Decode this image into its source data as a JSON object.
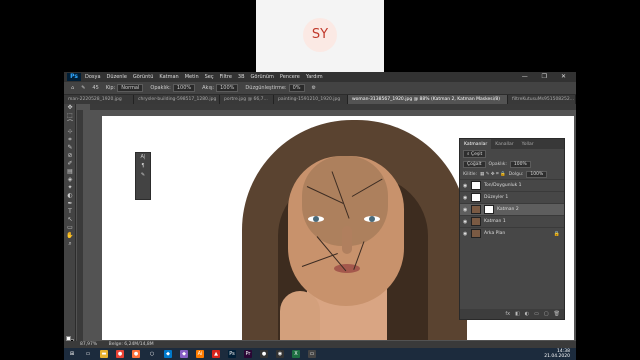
{
  "webcam": {
    "initials": "SY"
  },
  "menubar": {
    "items": [
      "Dosya",
      "Düzenle",
      "Görüntü",
      "Katman",
      "Metin",
      "Seç",
      "Filtre",
      "3B",
      "Görünüm",
      "Pencere",
      "Yardım"
    ],
    "window_controls": "— ❐ ✕"
  },
  "options": {
    "size": "45",
    "mode_label": "Kip:",
    "mode_value": "Normal",
    "opacity_label": "Opaklık:",
    "opacity_value": "100%",
    "flow_label": "Akış:",
    "flow_value": "100%",
    "smoothing_label": "Düzgünleştirme:",
    "smoothing_value": "0%"
  },
  "tabs": [
    {
      "label": "man-2220528_1920.jpg",
      "active": false
    },
    {
      "label": "chrysler-building-598517_1280.jpg",
      "active": false
    },
    {
      "label": "portre.jpg @ 66,7...",
      "active": false
    },
    {
      "label": "painting-1591210_1920.jpg",
      "active": false
    },
    {
      "label": "woman-3138567_1920.jpg @ 88% (Katman 2, Katman Maskesi/8)",
      "active": true
    },
    {
      "label": "filtreKutusuMs951508252...",
      "active": false
    }
  ],
  "tools": [
    "✥",
    "⬚",
    "⌒",
    "⊹",
    "⌗",
    "✎",
    "⊘",
    "✐",
    "▤",
    "◈",
    "✦",
    "◐",
    "✒",
    "T",
    "↖",
    "▭",
    "✋",
    "⌕"
  ],
  "mini_panel": [
    "A|",
    "¶",
    "✎"
  ],
  "layers_panel": {
    "tabs": [
      "Katmanlar",
      "Kanallar",
      "Yollar"
    ],
    "filter_label": "Çeşit",
    "blend_mode": "Çoğalt",
    "opacity_label": "Opaklık:",
    "opacity_value": "100%",
    "lock_label": "Kilitle:",
    "fill_label": "Dolgu:",
    "fill_value": "100%",
    "layers": [
      {
        "name": "Ton/Doygunluk 1",
        "thumb": "white",
        "selected": false,
        "locked": false
      },
      {
        "name": "Düzeyler 1",
        "thumb": "white",
        "selected": false,
        "locked": false
      },
      {
        "name": "Katman 2",
        "thumb": "photo",
        "selected": true,
        "locked": false
      },
      {
        "name": "Katman 1",
        "thumb": "photo",
        "selected": false,
        "locked": false
      },
      {
        "name": "Arka Plan",
        "thumb": "photo",
        "selected": false,
        "locked": true
      }
    ],
    "bottom_icons": [
      "fx",
      "◧",
      "◐",
      "▭",
      "▢",
      "🗑"
    ]
  },
  "status": {
    "zoom": "87,97%",
    "doc": "Belge: 6,24M/14,8M"
  },
  "taskbar": {
    "icons": [
      {
        "name": "windows-icon",
        "glyph": "⊞",
        "color": "#1c2b3d"
      },
      {
        "name": "task-view-icon",
        "glyph": "▭",
        "color": "#1c2b3d"
      },
      {
        "name": "folder-icon",
        "glyph": "▬",
        "color": "#e6b12e"
      },
      {
        "name": "chrome-icon",
        "glyph": "●",
        "color": "#e94235"
      },
      {
        "name": "firefox-icon",
        "glyph": "●",
        "color": "#ff7139"
      },
      {
        "name": "cortana-icon",
        "glyph": "○",
        "color": "#1c2b3d"
      },
      {
        "name": "vscode-icon",
        "glyph": "◆",
        "color": "#007acc"
      },
      {
        "name": "vs-icon",
        "glyph": "◆",
        "color": "#865fc5"
      },
      {
        "name": "illustrator-icon",
        "glyph": "Ai",
        "color": "#ff7c00"
      },
      {
        "name": "acrobat-icon",
        "glyph": "▲",
        "color": "#d8231b"
      },
      {
        "name": "photoshop-icon",
        "glyph": "Ps",
        "color": "#001e36"
      },
      {
        "name": "premiere-icon",
        "glyph": "Pr",
        "color": "#2a0634"
      },
      {
        "name": "obs-icon",
        "glyph": "●",
        "color": "#333333"
      },
      {
        "name": "webcam-icon",
        "glyph": "◉",
        "color": "#333333"
      },
      {
        "name": "excel-icon",
        "glyph": "X",
        "color": "#1d6f42"
      },
      {
        "name": "files-icon",
        "glyph": "▭",
        "color": "#444444"
      }
    ],
    "time": "14:38",
    "date": "21.04.2020"
  }
}
